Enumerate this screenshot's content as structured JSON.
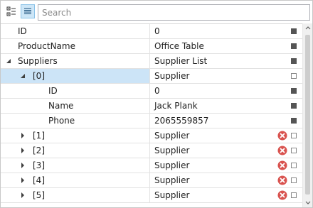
{
  "toolbar": {
    "categorized_icon": "categorized-view-icon",
    "alphabetical_icon": "alphabetical-view-icon",
    "search_placeholder": "Search"
  },
  "rows": [
    {
      "name": "ID",
      "value": "0",
      "indent": 0,
      "expander": "none",
      "marker": "filled",
      "error": false,
      "selected": false
    },
    {
      "name": "ProductName",
      "value": "Office Table",
      "indent": 0,
      "expander": "none",
      "marker": "filled",
      "error": false,
      "selected": false
    },
    {
      "name": "Suppliers",
      "value": "Supplier List",
      "indent": 0,
      "expander": "expanded",
      "marker": "filled",
      "error": false,
      "selected": false
    },
    {
      "name": "[0]",
      "value": "Supplier",
      "indent": 1,
      "expander": "expanded",
      "marker": "empty",
      "error": false,
      "selected": true
    },
    {
      "name": "ID",
      "value": "0",
      "indent": 2,
      "expander": "none",
      "marker": "filled",
      "error": false,
      "selected": false
    },
    {
      "name": "Name",
      "value": "Jack Plank",
      "indent": 2,
      "expander": "none",
      "marker": "filled",
      "error": false,
      "selected": false
    },
    {
      "name": "Phone",
      "value": "2065559857",
      "indent": 2,
      "expander": "none",
      "marker": "filled",
      "error": false,
      "selected": false
    },
    {
      "name": "[1]",
      "value": "Supplier",
      "indent": 1,
      "expander": "collapsed",
      "marker": "empty",
      "error": true,
      "selected": false
    },
    {
      "name": "[2]",
      "value": "Supplier",
      "indent": 1,
      "expander": "collapsed",
      "marker": "empty",
      "error": true,
      "selected": false
    },
    {
      "name": "[3]",
      "value": "Supplier",
      "indent": 1,
      "expander": "collapsed",
      "marker": "empty",
      "error": true,
      "selected": false
    },
    {
      "name": "[4]",
      "value": "Supplier",
      "indent": 1,
      "expander": "collapsed",
      "marker": "empty",
      "error": true,
      "selected": false
    },
    {
      "name": "[5]",
      "value": "Supplier",
      "indent": 1,
      "expander": "collapsed",
      "marker": "empty",
      "error": true,
      "selected": false
    }
  ],
  "colors": {
    "selection": "#cce4f7",
    "error": "#d9534f",
    "marker": "#555555"
  }
}
